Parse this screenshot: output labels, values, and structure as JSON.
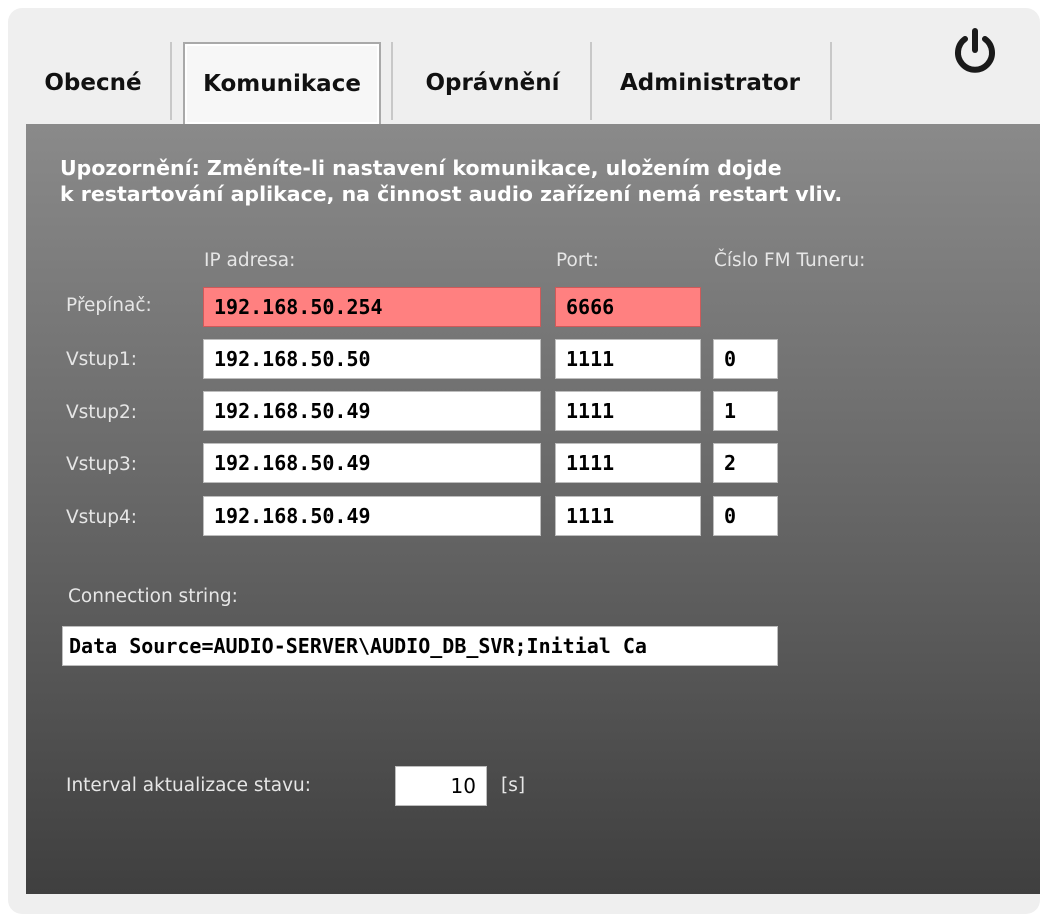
{
  "tabs": [
    "Obecné",
    "Komunikace",
    "Oprávnění",
    "Administrator"
  ],
  "active_tab": "Komunikace",
  "power_icon": "power-icon",
  "warning": {
    "line1": "Upozornění: Změníte-li nastavení komunikace, uložením dojde",
    "line2": "k restartování aplikace, na činnost audio zařízení nemá restart vliv."
  },
  "columns": {
    "ip": "IP adresa:",
    "port": "Port:",
    "tuner": "Číslo FM Tuneru:"
  },
  "rows": [
    {
      "label": "Přepínač:",
      "ip": "192.168.50.254",
      "port": "6666",
      "tuner": null,
      "error": true
    },
    {
      "label": "Vstup1:",
      "ip": "192.168.50.50",
      "port": "1111",
      "tuner": "0",
      "error": false
    },
    {
      "label": "Vstup2:",
      "ip": "192.168.50.49",
      "port": "1111",
      "tuner": "1",
      "error": false
    },
    {
      "label": "Vstup3:",
      "ip": "192.168.50.49",
      "port": "1111",
      "tuner": "2",
      "error": false
    },
    {
      "label": "Vstup4:",
      "ip": "192.168.50.49",
      "port": "1111",
      "tuner": "0",
      "error": false
    }
  ],
  "connection": {
    "label": "Connection string:",
    "value": "Data Source=AUDIO-SERVER\\AUDIO_DB_SVR;Initial Ca"
  },
  "interval": {
    "label": "Interval aktualizace stavu:",
    "value": "10",
    "unit": "[s]"
  },
  "colors": {
    "error_field": "#ff8080",
    "panel_top": "#8a8a8a",
    "panel_bottom": "#3f3f3f"
  }
}
